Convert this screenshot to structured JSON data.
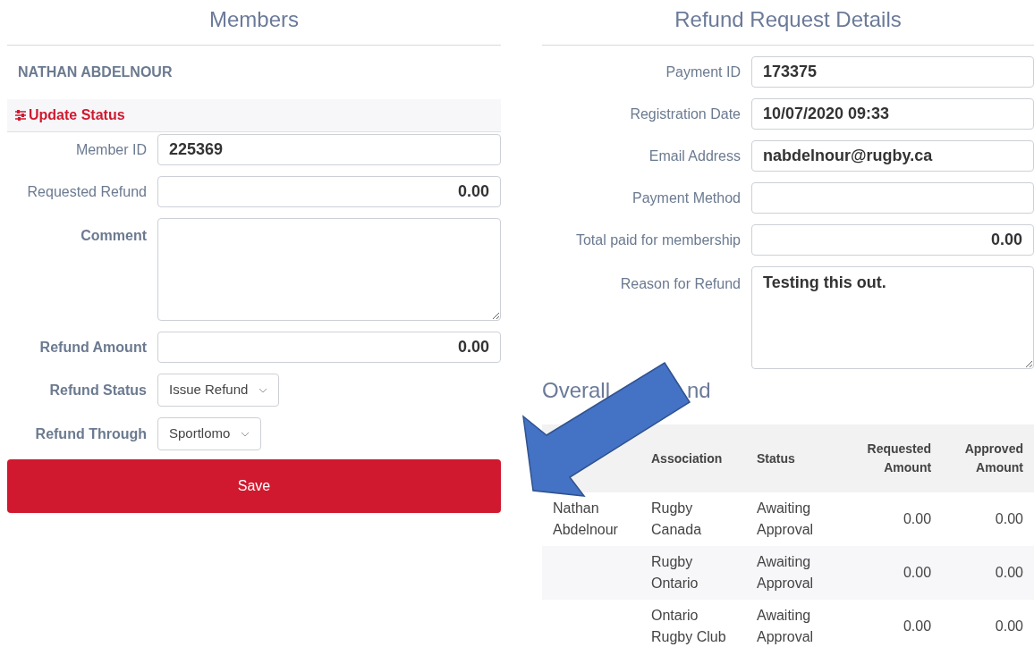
{
  "members": {
    "title": "Members",
    "member_name": "NATHAN ABDELNOUR",
    "section": "Update Status",
    "fields": [
      {
        "kind": "text",
        "label": "Member ID",
        "value": "225369",
        "editable": false
      },
      {
        "kind": "amount",
        "label": "Requested Refund",
        "value": "0.00",
        "editable": false
      },
      {
        "kind": "textarea",
        "label": "Comment",
        "editable": true
      },
      {
        "kind": "amount",
        "label": "Refund Amount",
        "value": "0.00",
        "editable": true
      },
      {
        "kind": "select",
        "label": "Refund Status",
        "value": "Issue Refund",
        "editable": true
      },
      {
        "kind": "select",
        "label": "Refund Through",
        "value": "Sportlomo",
        "editable": true
      }
    ],
    "save_button": "Save"
  },
  "refund_details": {
    "title": "Refund Request Details",
    "fields": [
      {
        "kind": "text",
        "label": "Payment ID",
        "value": "173375"
      },
      {
        "kind": "text",
        "label": "Registration Date",
        "value": "10/07/2020 09:33"
      },
      {
        "kind": "text",
        "label": "Email Address",
        "value": "nabdelnour@rugby.ca"
      },
      {
        "kind": "text",
        "label": "Payment Method"
      },
      {
        "kind": "amount",
        "label": "Total paid for membership",
        "value": "0.00"
      },
      {
        "kind": "textarea",
        "label": "Reason for Refund",
        "value": "Testing this out."
      }
    ]
  },
  "overall_refund": {
    "title": "Overall",
    "title_tail": "nd",
    "columns": [
      "",
      "Association",
      "Status",
      "Requested Amount",
      "Approved Amount"
    ],
    "rows": [
      [
        "Nathan Abdelnour",
        "Rugby Canada",
        "Awaiting Approval",
        "0.00",
        "0.00"
      ],
      [
        "",
        "Rugby Ontario",
        "Awaiting Approval",
        "0.00",
        "0.00"
      ],
      [
        "",
        "Ontario Rugby Club",
        "Awaiting Approval",
        "0.00",
        "0.00"
      ]
    ]
  }
}
